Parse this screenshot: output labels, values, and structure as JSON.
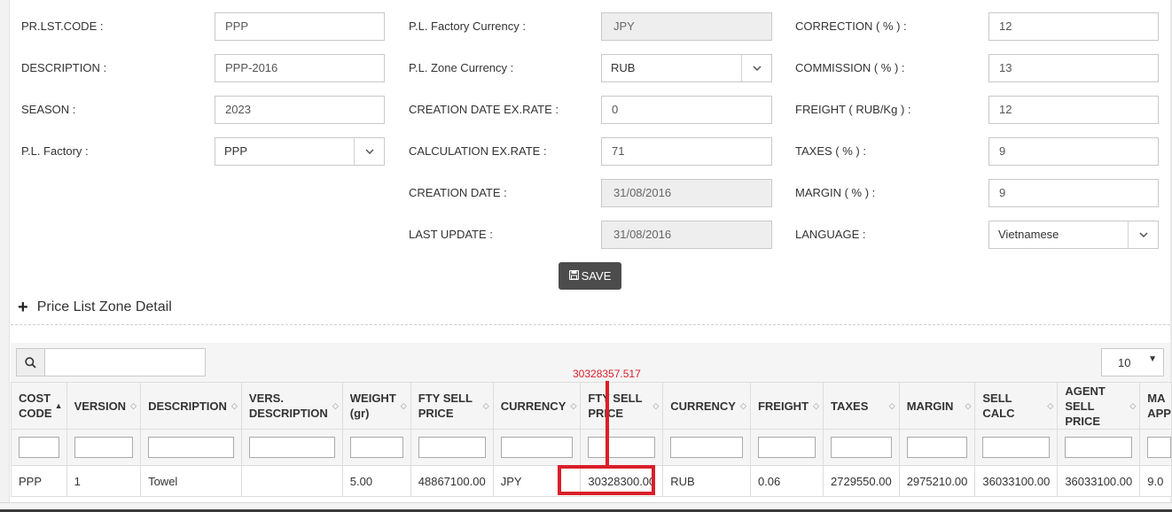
{
  "form": {
    "col1": [
      {
        "label": "PR.LST.CODE :",
        "value": "PPP",
        "type": "input"
      },
      {
        "label": "DESCRIPTION :",
        "value": "PPP-2016",
        "type": "input"
      },
      {
        "label": "SEASON :",
        "value": "2023",
        "type": "input"
      },
      {
        "label": "P.L. Factory :",
        "value": "PPP",
        "type": "select"
      }
    ],
    "col2": [
      {
        "label": "P.L. Factory Currency :",
        "value": "JPY",
        "type": "readonly"
      },
      {
        "label": "P.L. Zone Currency :",
        "value": "RUB",
        "type": "select"
      },
      {
        "label": "CREATION DATE EX.RATE :",
        "value": "0",
        "type": "input"
      },
      {
        "label": "CALCULATION EX.RATE :",
        "value": "71",
        "type": "input"
      },
      {
        "label": "CREATION DATE :",
        "value": "31/08/2016",
        "type": "readonly"
      },
      {
        "label": "LAST UPDATE :",
        "value": "31/08/2016",
        "type": "readonly"
      }
    ],
    "col3": [
      {
        "label": "CORRECTION ( % ) :",
        "value": "12",
        "type": "input"
      },
      {
        "label": "COMMISSION ( % ) :",
        "value": "13",
        "type": "input"
      },
      {
        "label": "FREIGHT ( RUB/Kg ) :",
        "value": "12",
        "type": "input"
      },
      {
        "label": "TAXES ( % ) :",
        "value": "9",
        "type": "input"
      },
      {
        "label": "MARGIN ( % ) :",
        "value": "9",
        "type": "input"
      },
      {
        "label": "LANGUAGE :",
        "value": "Vietnamese",
        "type": "select"
      }
    ],
    "save_label": "SAVE"
  },
  "section": {
    "title": "Price List Zone Detail"
  },
  "table": {
    "page_size": "10",
    "columns": [
      {
        "label": "COST CODE",
        "sorted": "asc"
      },
      {
        "label": "VERSION"
      },
      {
        "label": "DESCRIPTION"
      },
      {
        "label": "VERS. DESCRIPTION"
      },
      {
        "label": "WEIGHT (gr)"
      },
      {
        "label": "FTY SELL PRICE"
      },
      {
        "label": "CURRENCY"
      },
      {
        "label": "FTY SELL PRICE"
      },
      {
        "label": "CURRENCY"
      },
      {
        "label": "FREIGHT"
      },
      {
        "label": "TAXES"
      },
      {
        "label": "MARGIN"
      },
      {
        "label": "SELL CALC"
      },
      {
        "label": "AGENT SELL PRICE"
      },
      {
        "label": "MA APP"
      }
    ],
    "rows": [
      [
        "PPP",
        "1",
        "Towel",
        "",
        "5.00",
        "48867100.00",
        "JPY",
        "30328300.00",
        "RUB",
        "0.06",
        "2729550.00",
        "2975210.00",
        "36033100.00",
        "36033100.00",
        "9.0"
      ]
    ]
  },
  "annotation": {
    "text": "30328357.517",
    "color": "#d9202a"
  }
}
